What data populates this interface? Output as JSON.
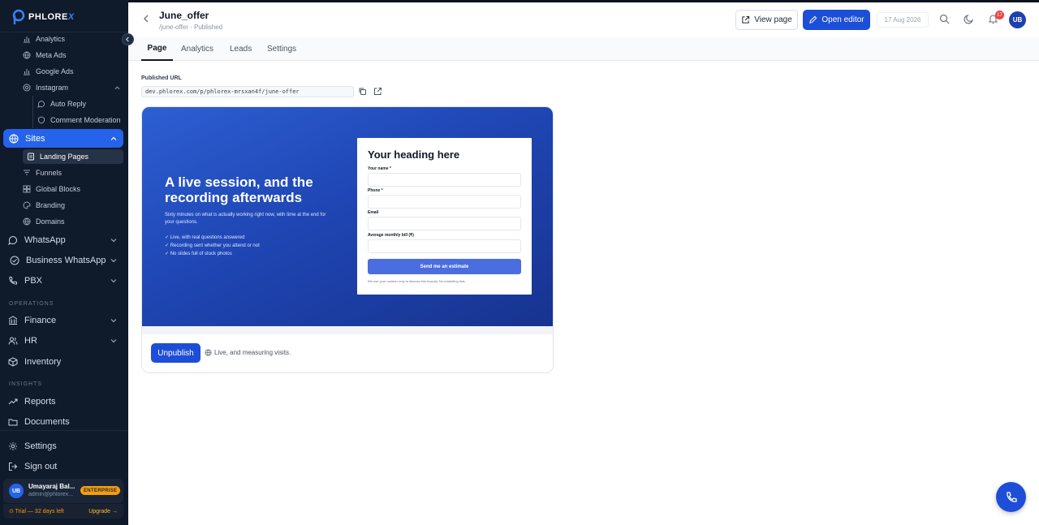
{
  "brand": {
    "logo_text": "PHLORE",
    "logo_accent": "X",
    "accent_color": "#2563eb"
  },
  "sidebar": {
    "marketing_items": [
      {
        "label": "Analytics",
        "icon": "bar-chart-icon"
      },
      {
        "label": "Meta Ads",
        "icon": "globe-icon"
      },
      {
        "label": "Google Ads",
        "icon": "bar-chart-icon"
      },
      {
        "label": "Instagram",
        "icon": "instagram-icon"
      }
    ],
    "instagram_items": [
      {
        "label": "Auto Reply",
        "icon": "chat-bubble-icon"
      },
      {
        "label": "Comment Moderation",
        "icon": "shield-icon"
      }
    ],
    "sites": {
      "label": "Sites",
      "icon": "globe-icon"
    },
    "sites_items": [
      {
        "label": "Landing Pages",
        "icon": "document-icon",
        "active": true
      },
      {
        "label": "Funnels",
        "icon": "funnel-icon"
      },
      {
        "label": "Global Blocks",
        "icon": "blocks-icon"
      },
      {
        "label": "Branding",
        "icon": "palette-icon"
      },
      {
        "label": "Domains",
        "icon": "globe-icon"
      }
    ],
    "channels": [
      {
        "label": "WhatsApp",
        "icon": "chat-bubble-icon"
      },
      {
        "label": "Business WhatsApp",
        "icon": "check-circle-icon"
      },
      {
        "label": "PBX",
        "icon": "phone-icon"
      }
    ],
    "operations_label": "OPERATIONS",
    "operations": [
      {
        "label": "Finance",
        "icon": "bank-icon"
      },
      {
        "label": "HR",
        "icon": "users-icon"
      },
      {
        "label": "Inventory",
        "icon": "box-icon"
      }
    ],
    "insights_label": "INSIGHTS",
    "insights": [
      {
        "label": "Reports",
        "icon": "trend-icon"
      },
      {
        "label": "Documents",
        "icon": "folder-icon"
      }
    ],
    "settings_label": "Settings",
    "signout_label": "Sign out",
    "user": {
      "initials": "UB",
      "name": "Umayaraj Bal...",
      "email": "admin@phlorex...",
      "plan": "ENTERPRISE"
    },
    "trial": {
      "text": "⊙ Trial — 32 days left",
      "upgrade": "Upgrade →"
    }
  },
  "header": {
    "title": "June_offer",
    "subtitle": "/june-offer · Published",
    "view_page_label": "View page",
    "open_editor_label": "Open editor",
    "date": "17 Aug 2026",
    "notification_count": "17",
    "avatar_initials": "UB"
  },
  "tabs": [
    {
      "label": "Page",
      "active": true
    },
    {
      "label": "Analytics"
    },
    {
      "label": "Leads"
    },
    {
      "label": "Settings"
    }
  ],
  "published": {
    "label": "Published URL",
    "url": "dev.phlorex.com/p/phlorex-mrsxan4f/june-offer"
  },
  "preview": {
    "hero_title": "A live session, and the recording afterwards",
    "hero_desc": "Sixty minutes on what is actually working right now, with time at the end for your questions.",
    "hero_points": [
      "✓ Live, with real questions answered",
      "✓ Recording sent whether you attend or not",
      "✓ No slides full of stock photos"
    ],
    "form": {
      "heading": "Your heading here",
      "fields": [
        "Your name *",
        "Phone *",
        "Email",
        "Average monthly bill (₹)"
      ],
      "submit": "Send me an estimate",
      "note": "We use your number only to discuss this enquiry. No marketing lists."
    }
  },
  "footer": {
    "unpublish_label": "Unpublish",
    "status_text": "Live, and measuring visits."
  }
}
